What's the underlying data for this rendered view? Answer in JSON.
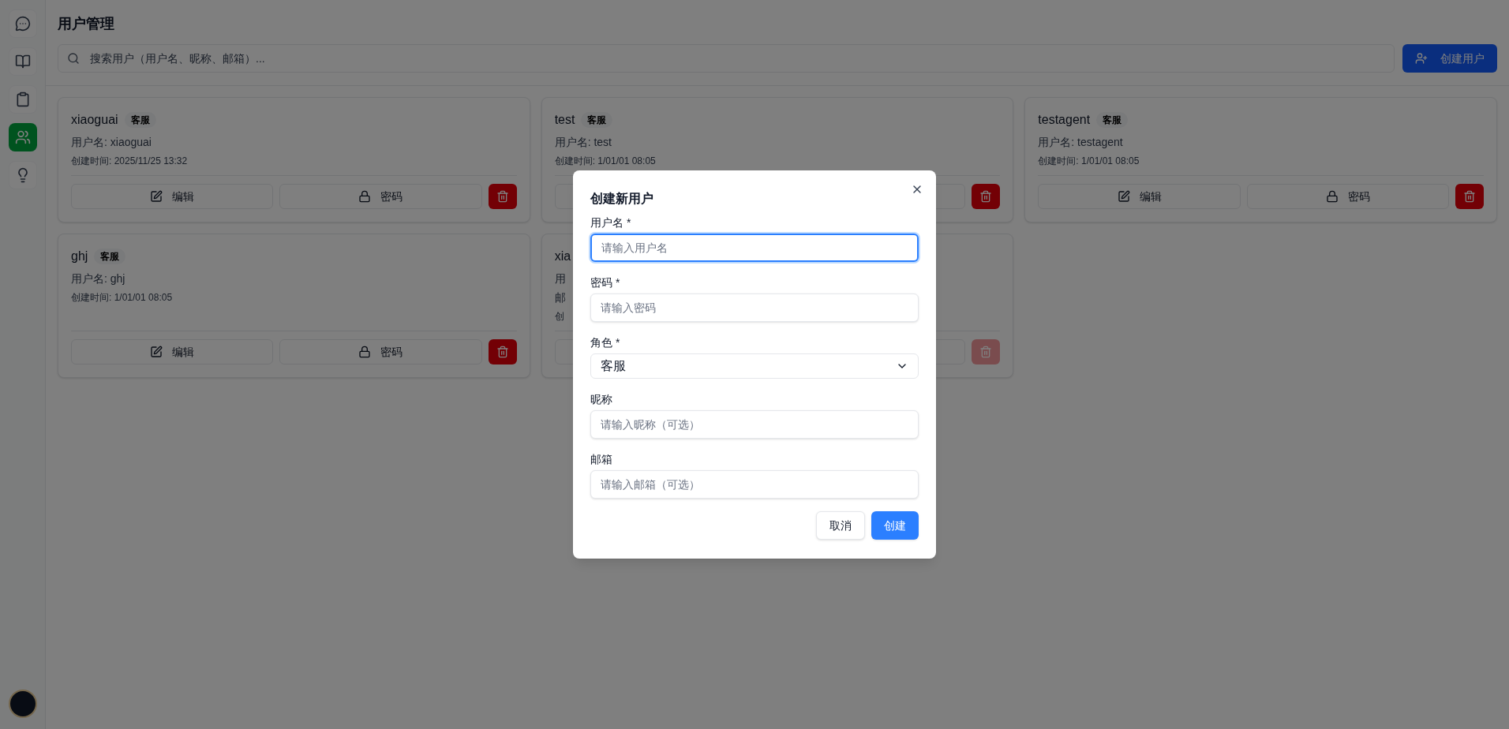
{
  "sidebar": {
    "items": [
      {
        "selected": false
      },
      {
        "selected": false
      },
      {
        "selected": false
      },
      {
        "selected": true
      },
      {
        "selected": false
      }
    ]
  },
  "header": {
    "title": "用户管理",
    "search": {
      "placeholder": "搜索用户（用户名、昵称、邮箱）..."
    },
    "create_button": "创建用户"
  },
  "users": [
    {
      "name": "xiaoguai",
      "role": "客服",
      "username": "用户名: xiaoguai",
      "created": "创建时间: 2025/11/25 13:32",
      "edit": "编辑",
      "password": "密码",
      "delete_disabled": false
    },
    {
      "name": "test",
      "role": "客服",
      "username": "用户名: test",
      "created": "创建时间: 1/01/01 08:05",
      "delete_disabled": false
    },
    {
      "name": "testagent",
      "role": "客服",
      "username": "用户名: testagent",
      "created": "创建时间: 1/01/01 08:05",
      "edit": "编辑",
      "password": "密码",
      "delete_disabled": false
    },
    {
      "name": "ghj",
      "role": "客服",
      "username": "用户名: ghj",
      "created": "创建时间: 1/01/01 08:05",
      "edit": "编辑",
      "password": "密码",
      "delete_disabled": false
    },
    {
      "name": "xia",
      "username": "用",
      "email": "邮",
      "created": "创",
      "delete_disabled": true
    }
  ],
  "dialog": {
    "title": "创建新用户",
    "fields": [
      {
        "kind": "text",
        "label": "用户名 *",
        "placeholder": "请输入用户名",
        "focused": true
      },
      {
        "kind": "text",
        "label": "密码 *",
        "placeholder": "请输入密码",
        "focused": false
      },
      {
        "kind": "select",
        "label": "角色 *",
        "value": "客服",
        "focused": false
      },
      {
        "kind": "text",
        "label": "昵称",
        "placeholder": "请输入昵称（可选）",
        "focused": false
      },
      {
        "kind": "text",
        "label": "邮箱",
        "placeholder": "请输入邮箱（可选）",
        "focused": false
      }
    ],
    "cancel": "取消",
    "submit": "创建"
  }
}
